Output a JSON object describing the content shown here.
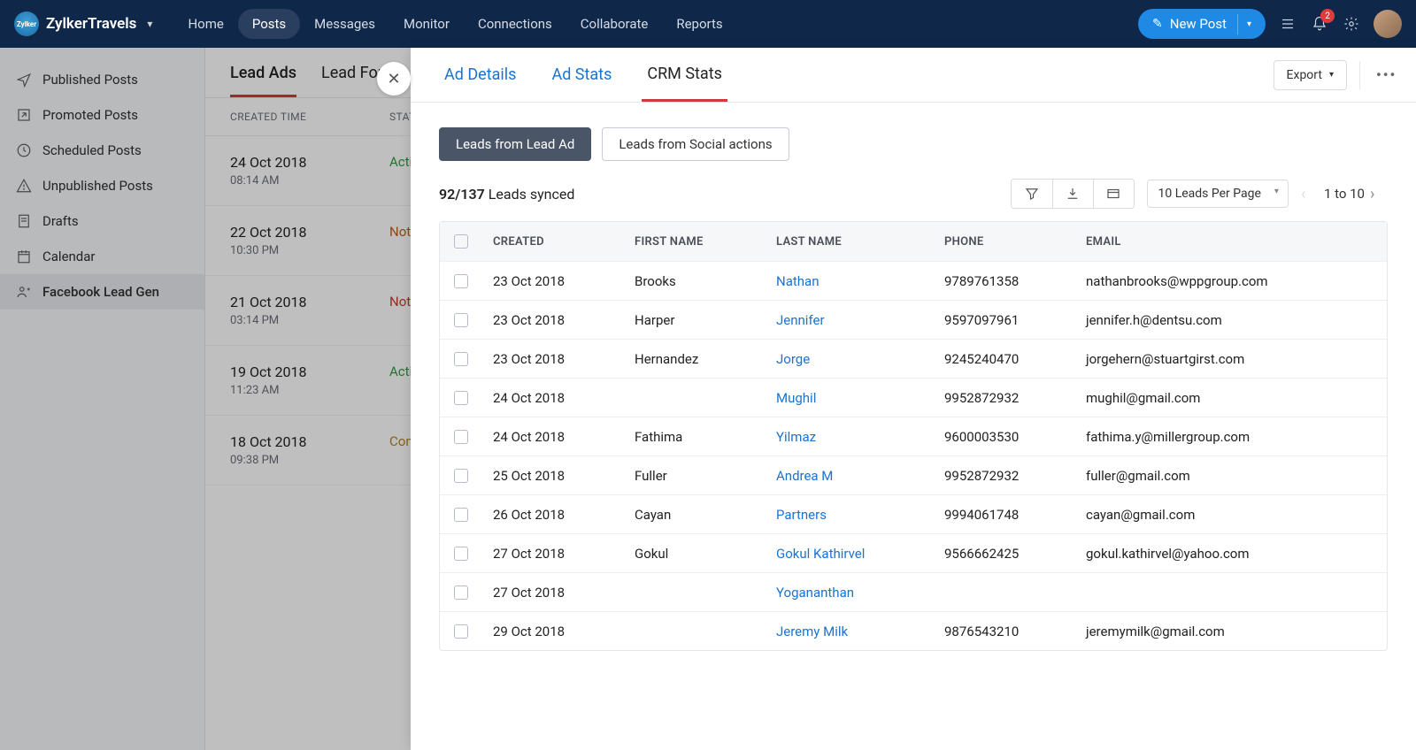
{
  "brand": {
    "name": "ZylkerTravels",
    "logo_text": "Zylker"
  },
  "nav": {
    "items": [
      "Home",
      "Posts",
      "Messages",
      "Monitor",
      "Connections",
      "Collaborate",
      "Reports"
    ],
    "active_index": 1,
    "new_post": "New Post",
    "notif_count": "2"
  },
  "sidebar": {
    "items": [
      {
        "icon": "send",
        "label": "Published Posts"
      },
      {
        "icon": "external",
        "label": "Promoted Posts"
      },
      {
        "icon": "clock",
        "label": "Scheduled Posts"
      },
      {
        "icon": "warn",
        "label": "Unpublished Posts"
      },
      {
        "icon": "draft",
        "label": "Drafts"
      },
      {
        "icon": "calendar",
        "label": "Calendar"
      },
      {
        "icon": "leadgen",
        "label": "Facebook Lead Gen"
      }
    ],
    "active_index": 6
  },
  "bg": {
    "tabs": [
      "Lead Ads",
      "Lead Form"
    ],
    "active_tab": 0,
    "headers": {
      "created": "CREATED TIME",
      "status": "STATUS"
    },
    "rows": [
      {
        "date": "24 Oct 2018",
        "time": "08:14 AM",
        "status": "Active",
        "cls": "st-active"
      },
      {
        "date": "22 Oct 2018",
        "time": "10:30 PM",
        "status": "Not approved",
        "cls": "st-notapp"
      },
      {
        "date": "21 Oct 2018",
        "time": "03:14 PM",
        "status": "Not delivered",
        "cls": "st-notdeliver"
      },
      {
        "date": "19 Oct 2018",
        "time": "11:23 AM",
        "status": "Active",
        "cls": "st-active"
      },
      {
        "date": "18 Oct 2018",
        "time": "09:38 PM",
        "status": "Completed",
        "cls": "st-complete"
      }
    ]
  },
  "panel": {
    "tabs": [
      "Ad Details",
      "Ad Stats",
      "CRM Stats"
    ],
    "active_tab": 2,
    "export": "Export",
    "subtabs": {
      "a": "Leads from Lead Ad",
      "b": "Leads from Social actions"
    },
    "synced": {
      "numer": "92",
      "denom": "137",
      "label": "Leads synced"
    },
    "perpage": "10 Leads Per Page",
    "pager": "1 to 10",
    "headers": {
      "created": "CREATED",
      "first": "FIRST NAME",
      "last": "LAST NAME",
      "phone": "PHONE",
      "email": "EMAIL"
    },
    "rows": [
      {
        "created": "23 Oct 2018",
        "first": "Brooks",
        "last": "Nathan",
        "phone": "9789761358",
        "email": "nathanbrooks@wppgroup.com"
      },
      {
        "created": "23 Oct 2018",
        "first": "Harper",
        "last": "Jennifer",
        "phone": "9597097961",
        "email": "jennifer.h@dentsu.com"
      },
      {
        "created": "23 Oct 2018",
        "first": "Hernandez",
        "last": "Jorge",
        "phone": "9245240470",
        "email": "jorgehern@stuartgirst.com"
      },
      {
        "created": "24 Oct 2018",
        "first": "",
        "last": "Mughil",
        "phone": "9952872932",
        "email": "mughil@gmail.com"
      },
      {
        "created": "24 Oct 2018",
        "first": "Fathima",
        "last": "Yilmaz",
        "phone": "9600003530",
        "email": "fathima.y@millergroup.com"
      },
      {
        "created": "25 Oct 2018",
        "first": "Fuller",
        "last": "Andrea M",
        "phone": "9952872932",
        "email": "fuller@gmail.com"
      },
      {
        "created": "26 Oct 2018",
        "first": "Cayan",
        "last": "Partners",
        "phone": "9994061748",
        "email": "cayan@gmail.com"
      },
      {
        "created": "27 Oct 2018",
        "first": "Gokul",
        "last": "Gokul Kathirvel",
        "phone": "9566662425",
        "email": "gokul.kathirvel@yahoo.com"
      },
      {
        "created": "27 Oct 2018",
        "first": "",
        "last": "Yogananthan",
        "phone": "",
        "email": ""
      },
      {
        "created": "29 Oct 2018",
        "first": "",
        "last": "Jeremy Milk",
        "phone": "9876543210",
        "email": "jeremymilk@gmail.com"
      }
    ]
  }
}
